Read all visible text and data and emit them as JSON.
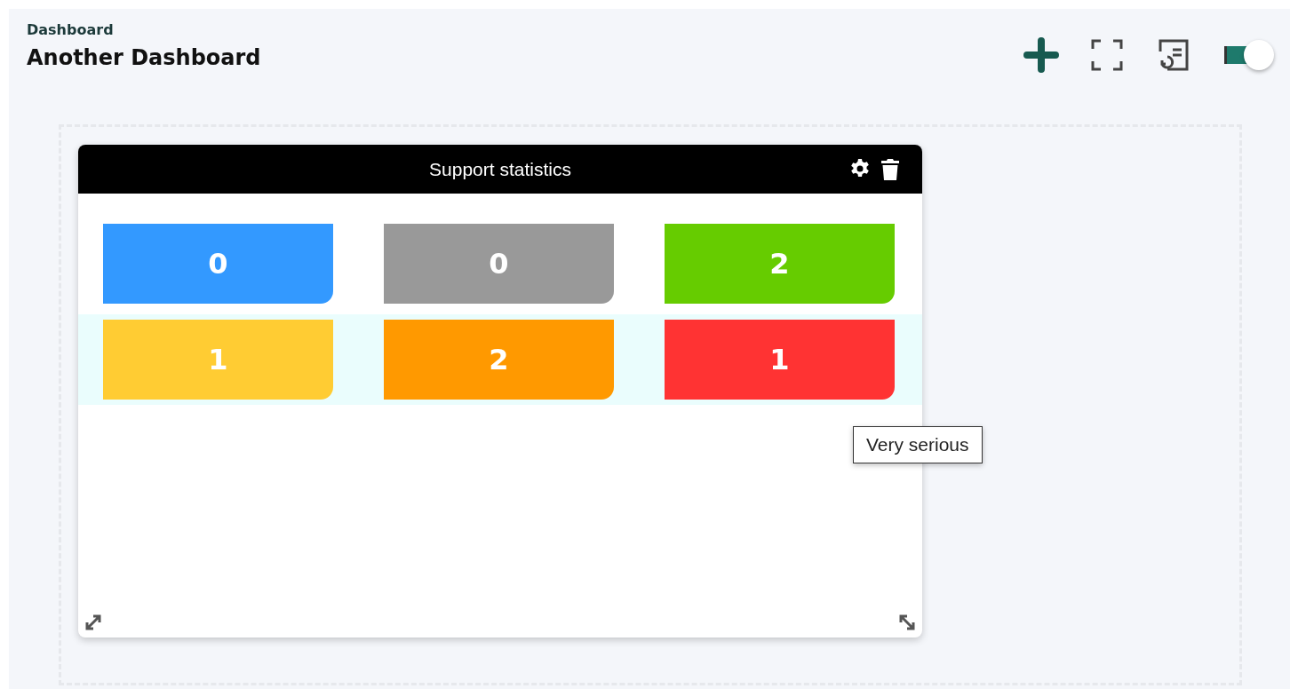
{
  "breadcrumb": "Dashboard",
  "title": "Another Dashboard",
  "toolbar": {
    "edit_mode": {
      "on": true
    }
  },
  "widget": {
    "title": "Support statistics",
    "rows": [
      {
        "highlighted": false,
        "tiles": [
          {
            "value": "0",
            "color": "#3399ff"
          },
          {
            "value": "0",
            "color": "#999999"
          },
          {
            "value": "2",
            "color": "#66cc00"
          }
        ]
      },
      {
        "highlighted": true,
        "tiles": [
          {
            "value": "1",
            "color": "#ffcc33"
          },
          {
            "value": "2",
            "color": "#ff9900"
          },
          {
            "value": "1",
            "color": "#ff3333"
          }
        ]
      }
    ],
    "tooltip": "Very serious"
  }
}
